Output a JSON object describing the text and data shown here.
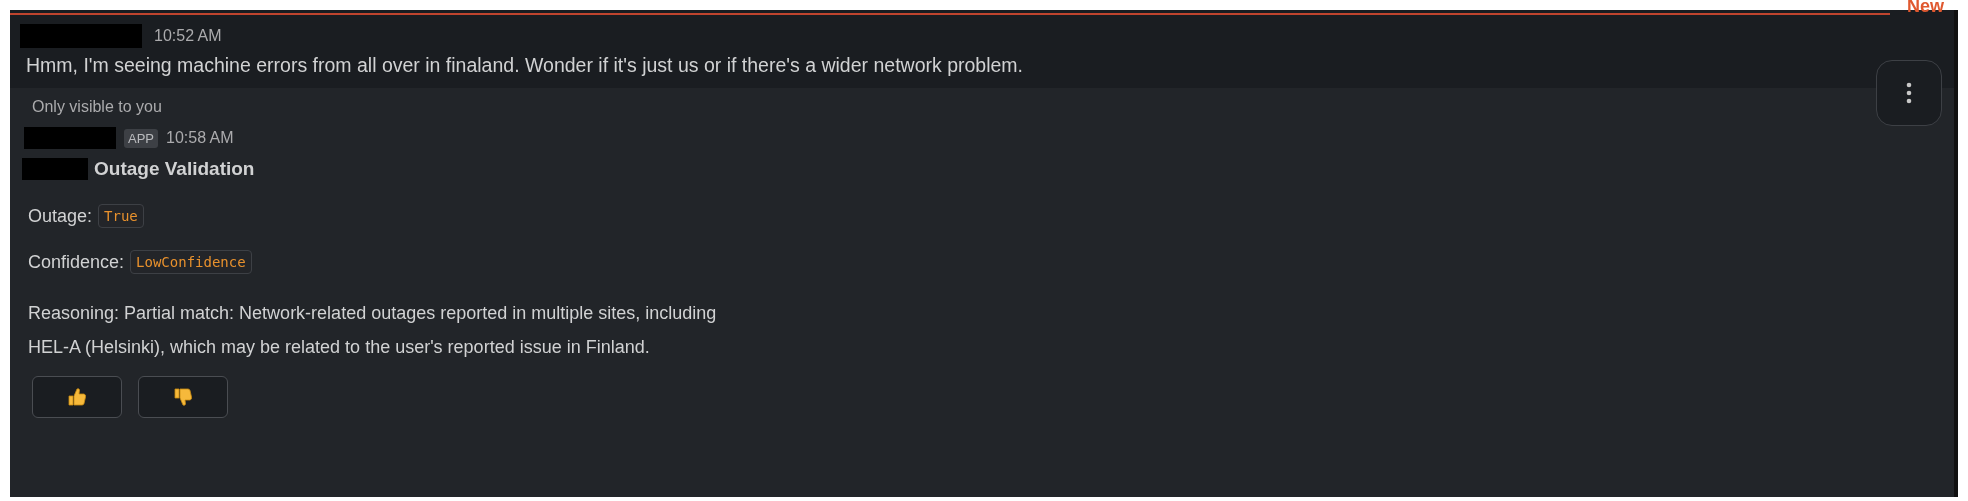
{
  "new_divider": {
    "label": "New"
  },
  "messages": [
    {
      "time": "10:52 AM",
      "text": "Hmm, I'm seeing machine errors from all over in finaland.  Wonder if it's just us or if there's a wider network problem."
    }
  ],
  "ephemeral": {
    "notice": "Only visible to you",
    "badge": "APP",
    "time": "10:58 AM",
    "title": "Outage Validation",
    "fields": [
      {
        "label": "Outage:",
        "value": "True"
      },
      {
        "label": "Confidence:",
        "value": "LowConfidence"
      }
    ],
    "reasoning": [
      "Reasoning: Partial match: Network-related outages reported in multiple sites, including",
      "HEL-A (Helsinki), which may be related to the user's reported issue in Finland."
    ],
    "reactions": [
      {
        "kind": "thumbs_up"
      },
      {
        "kind": "thumbs_down"
      }
    ]
  }
}
